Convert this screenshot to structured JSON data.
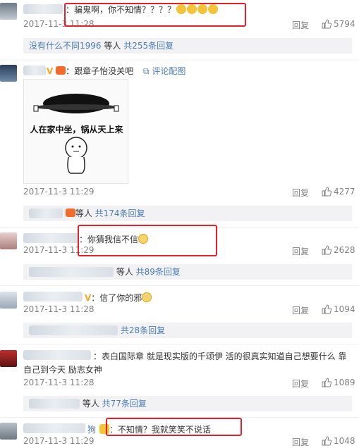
{
  "comments": [
    {
      "text": "：骗鬼啊，你不知情？？？？",
      "time": "2017-11-3 11:28",
      "reply": "回复",
      "likes": "5794"
    },
    {
      "text": "：跟章子怡没关吧",
      "pic": "评论配图",
      "time": "2017-11-3 11:29",
      "reply": "回复",
      "likes": "4277",
      "meme_text": "人在家中坐，锅从天上来"
    },
    {
      "text": "：你猜我信不信",
      "time": "2017-11-3 11:29",
      "reply": "回复",
      "likes": "2628"
    },
    {
      "text": "：信了你的邪",
      "time": "2017-11-3 11:28",
      "reply": "回复",
      "likes": "1094"
    },
    {
      "text": "：表白国际章  就是现实版的千颂伊 活的很真实知道自己想要什么 靠",
      "text2": "自己到今天 励志女神",
      "time": "2017-11-3 11:28",
      "reply": "回复",
      "likes": "1089"
    },
    {
      "name_tail": "狗",
      "text": "：不知情？我就笑笑不说话",
      "time": "2017-11-3 11:29",
      "reply": "回复",
      "likes": "1048"
    }
  ],
  "replies": [
    {
      "name": "没有什么不同1996",
      "mid": " 等人 ",
      "link": "共255条回复"
    },
    {
      "mid": "等人 ",
      "link": "共174条回复"
    },
    {
      "mid": "等人 ",
      "link": "共89条回复"
    },
    {
      "link": "共28条回复"
    },
    {
      "mid": "等人 ",
      "link": "共77条回复"
    }
  ],
  "colors": {
    "highlight": "#e4202d",
    "link": "#4c7cb5",
    "meta": "#808080",
    "reply_bg": "#f2f2f5"
  }
}
